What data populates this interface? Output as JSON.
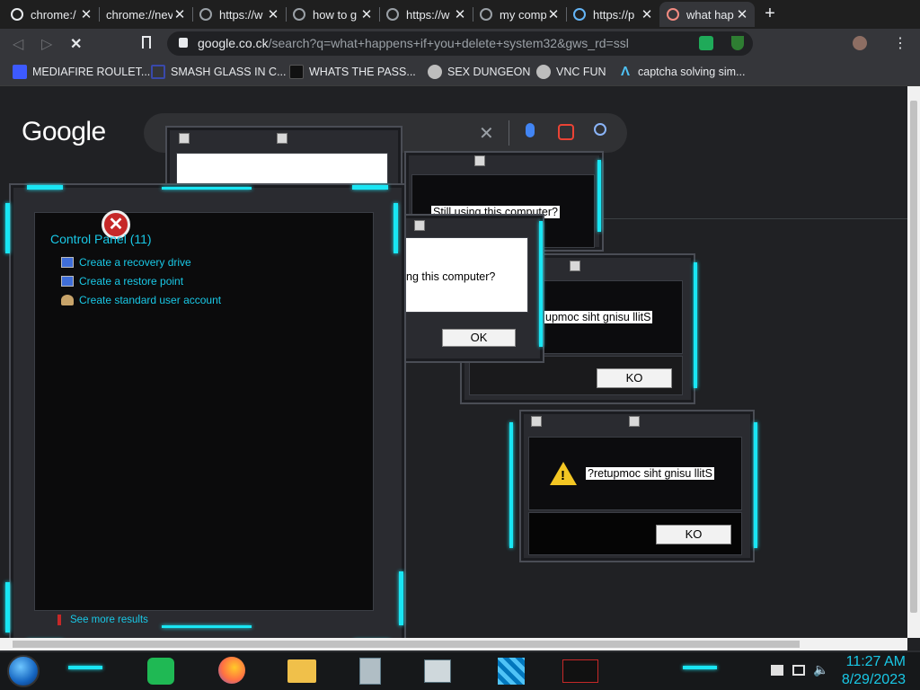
{
  "tabs": [
    {
      "title": "chrome:/",
      "icon": "history-icon"
    },
    {
      "title": "chrome://nev",
      "icon": "blank-icon"
    },
    {
      "title": "https://w",
      "icon": "globe-icon"
    },
    {
      "title": "how to g",
      "icon": "google-icon"
    },
    {
      "title": "https://w",
      "icon": "globe-icon"
    },
    {
      "title": "my comp",
      "icon": "google-icon"
    },
    {
      "title": "https://p",
      "icon": "globe-icon"
    },
    {
      "title": "what hap",
      "icon": "loading-icon",
      "active": true
    }
  ],
  "omnibox": {
    "url_host": "google.co.ck",
    "url_path": "/search?q=what+happens+if+you+delete+system32&gws_rd=ssl"
  },
  "bookmarks": [
    {
      "label": "MEDIAFIRE ROULET...",
      "color": "#3d5afe"
    },
    {
      "label": "SMASH GLASS IN C...",
      "color": "#3949ab"
    },
    {
      "label": "WHATS THE PASS...",
      "color": "#1a1a1a"
    },
    {
      "label": "SEX DUNGEON",
      "color": "#bdbdbd"
    },
    {
      "label": "VNC FUN",
      "color": "#bdbdbd"
    },
    {
      "label": "captcha solving sim...",
      "color": "#4fc3f7"
    }
  ],
  "google": {
    "logo": "Google"
  },
  "control_panel": {
    "title": "Control Panel (11)",
    "items": [
      "Create a recovery drive",
      "Create a restore point",
      "Create standard user account"
    ],
    "see_more": "See more results"
  },
  "dialogs": {
    "d1_text": "Still using this computer?",
    "d2_text": "ng this computer?",
    "d2_ok": "OK",
    "d3_text": "upmoc siht gnisu llitS",
    "d3_ok": "KO",
    "d4_text": "?retupmoc siht gnisu llitS",
    "d4_ok": "KO"
  },
  "clock": {
    "time": "11:27 AM",
    "date": "8/29/2023"
  },
  "colors": {
    "accent_cyan": "#19e6f4",
    "bg": "#202124"
  }
}
